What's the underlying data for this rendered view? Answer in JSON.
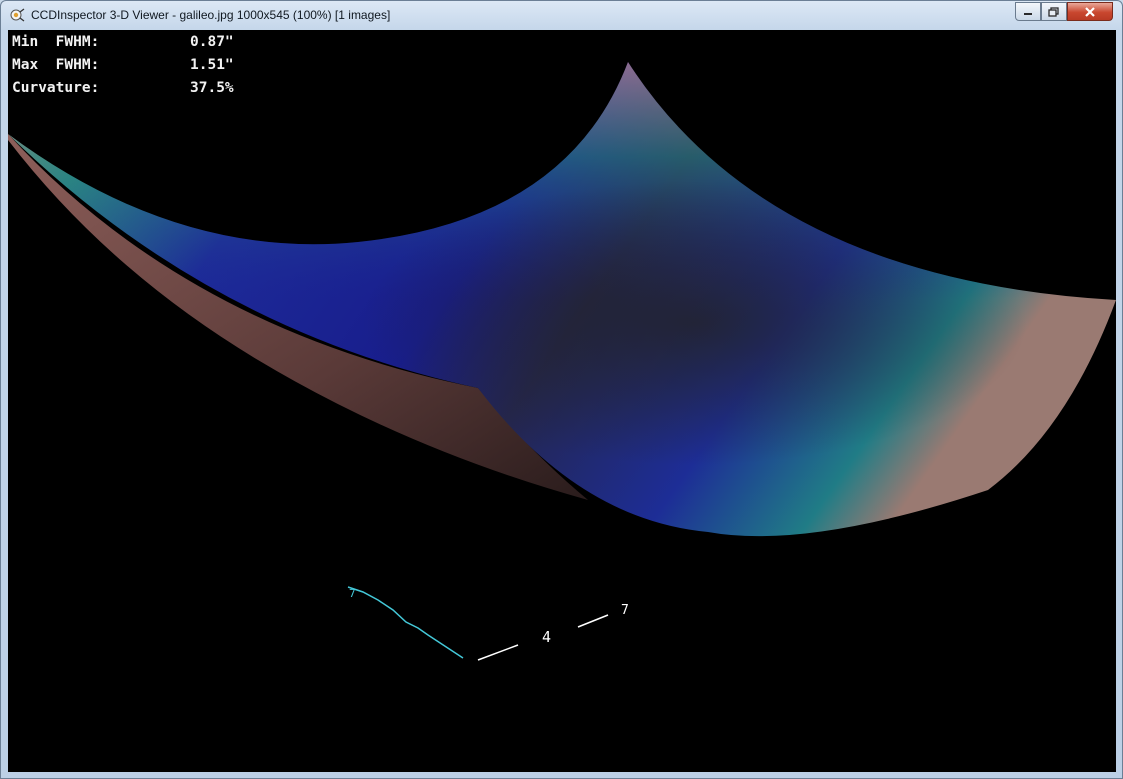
{
  "window": {
    "title": "CCDInspector 3-D Viewer - galileo.jpg 1000x545 (100%)  [1 images]",
    "icon": "ccdinspector-app-icon"
  },
  "controls": {
    "minimize_icon": "minimize-icon",
    "maximize_icon": "maximize-icon",
    "close_icon": "close-icon"
  },
  "stats": {
    "min_fwhm_label": "Min  FWHM:",
    "min_fwhm_value": "0.87\"",
    "max_fwhm_label": "Max  FWHM:",
    "max_fwhm_value": "1.51\"",
    "curvature_label": "Curvature:",
    "curvature_value": "37.5%"
  },
  "axis_labels": {
    "x": "7",
    "y": "4",
    "z": "7"
  },
  "colors": {
    "low": "#1c1f8e",
    "mid": "#1f7a78",
    "high": "#c08580",
    "background": "#000000"
  }
}
